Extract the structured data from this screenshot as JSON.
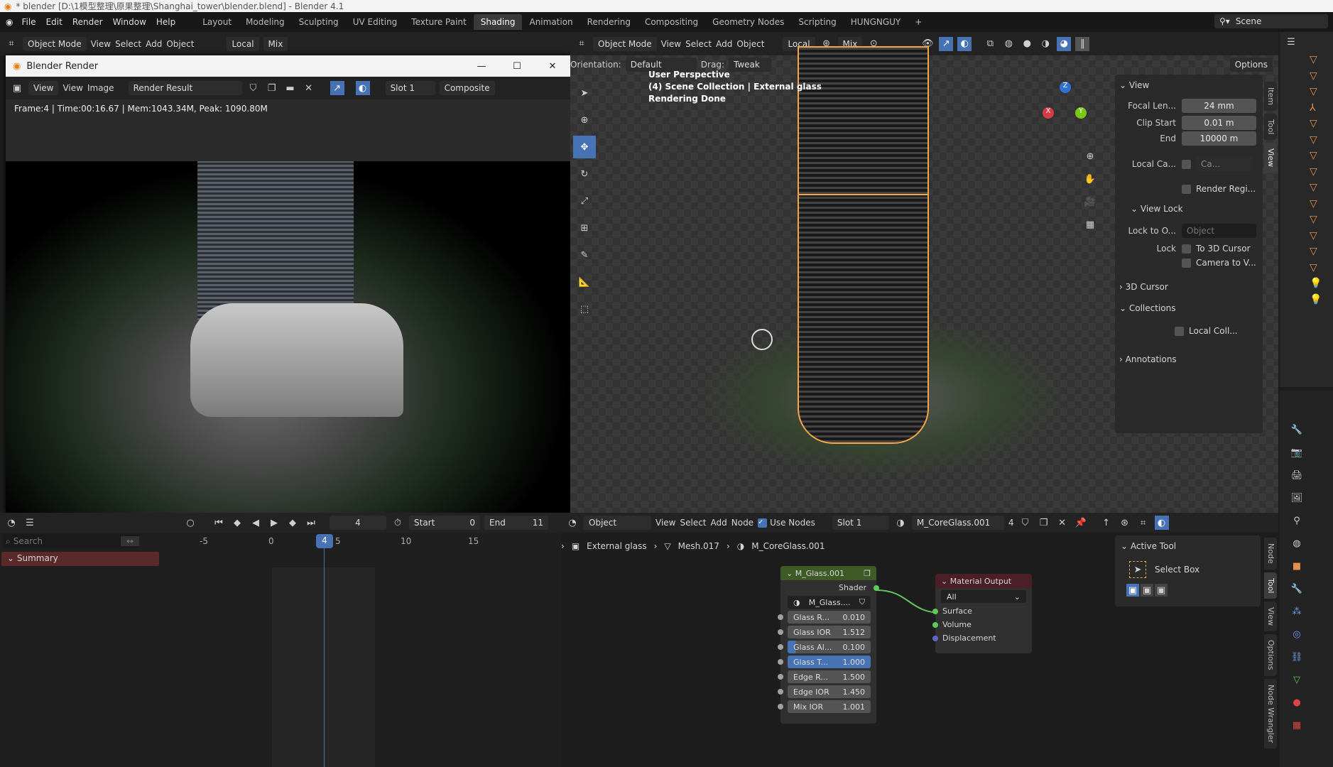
{
  "window_title": "* blender [D:\\1模型整理\\原果整理\\Shanghai_tower\\blender.blend] - Blender 4.1",
  "menu": [
    "File",
    "Edit",
    "Render",
    "Window",
    "Help"
  ],
  "workspaces": [
    "Layout",
    "Modeling",
    "Sculpting",
    "UV Editing",
    "Texture Paint",
    "Shading",
    "Animation",
    "Rendering",
    "Compositing",
    "Geometry Nodes",
    "Scripting",
    "HUNGNGUY"
  ],
  "active_workspace": "Shading",
  "scene": "Scene",
  "viewport_header": {
    "mode": "Object Mode",
    "menus": [
      "View",
      "Select",
      "Add",
      "Object"
    ],
    "transform": "Local",
    "pivot_mix": "Mix"
  },
  "viewport_row2": {
    "orientation_label": "Orientation:",
    "orientation": "Default",
    "drag_label": "Drag:",
    "drag": "Tweak",
    "options": "Options"
  },
  "viewport_overlay": [
    "User Perspective",
    "(4) Scene Collection | External glass",
    "Rendering Done"
  ],
  "render_window": {
    "title": "Blender Render",
    "view": "View",
    "menus": [
      "View",
      "Image"
    ],
    "image": "Render Result",
    "slot": "Slot 1",
    "pass": "Composite",
    "info": "Frame:4 | Time:00:16.67 | Mem:1043.34M, Peak: 1090.80M"
  },
  "n_panel": {
    "view_header": "View",
    "focal_label": "Focal Len...",
    "focal": "24 mm",
    "clip_start_label": "Clip Start",
    "clip_start": "0.01 m",
    "end_label": "End",
    "end": "10000 m",
    "local_cam_label": "Local Ca...",
    "local_cam": "Ca...",
    "render_region": "Render Regi...",
    "view_lock": "View Lock",
    "lock_to_label": "Lock to O...",
    "lock_to_placeholder": "Object",
    "lock_label": "Lock",
    "lock_cursor": "To 3D Cursor",
    "camera_to_view": "Camera to V...",
    "cursor_3d": "3D Cursor",
    "collections": "Collections",
    "local_coll": "Local Coll...",
    "annotations": "Annotations",
    "tabs": [
      "Item",
      "Tool",
      "View"
    ]
  },
  "timeline": {
    "current_frame": "4",
    "start_label": "Start",
    "start": "0",
    "end_label": "End",
    "end": "11",
    "search_placeholder": "Search",
    "summary": "Summary",
    "ticks": [
      "-5",
      "0",
      "5",
      "10",
      "15"
    ],
    "playhead": "4"
  },
  "node_editor": {
    "type": "Object",
    "menus": [
      "View",
      "Select",
      "Add",
      "Node"
    ],
    "use_nodes": "Use Nodes",
    "slot": "Slot 1",
    "material": "M_CoreGlass.001",
    "users": "4",
    "breadcrumb": [
      "External glass",
      "Mesh.017",
      "M_CoreGlass.001"
    ],
    "group_node": {
      "title": "M_Glass.001",
      "output": "Shader",
      "group": "M_Glass....",
      "inputs": [
        {
          "label": "Glass R...",
          "value": "0.010"
        },
        {
          "label": "Glass IOR",
          "value": "1.512"
        },
        {
          "label": "Glass Al...",
          "value": "0.100"
        },
        {
          "label": "Glass T...",
          "value": "1.000"
        },
        {
          "label": "Edge R...",
          "value": "1.500"
        },
        {
          "label": "Edge IOR",
          "value": "1.450"
        },
        {
          "label": "Mix IOR",
          "value": "1.001"
        }
      ]
    },
    "output_node": {
      "title": "Material Output",
      "target": "All",
      "inputs": [
        "Surface",
        "Volume",
        "Displacement"
      ]
    },
    "sidebar": {
      "header": "Active Tool",
      "tool": "Select Box",
      "tabs": [
        "Node",
        "Tool",
        "View",
        "Options",
        "Node Wrangler"
      ]
    }
  },
  "colors": {
    "accent": "#4772b3",
    "selection": "#f5a54a",
    "group_header": "#3e5a26",
    "output_header": "#4a1f27",
    "summary": "#5a2a2a"
  }
}
